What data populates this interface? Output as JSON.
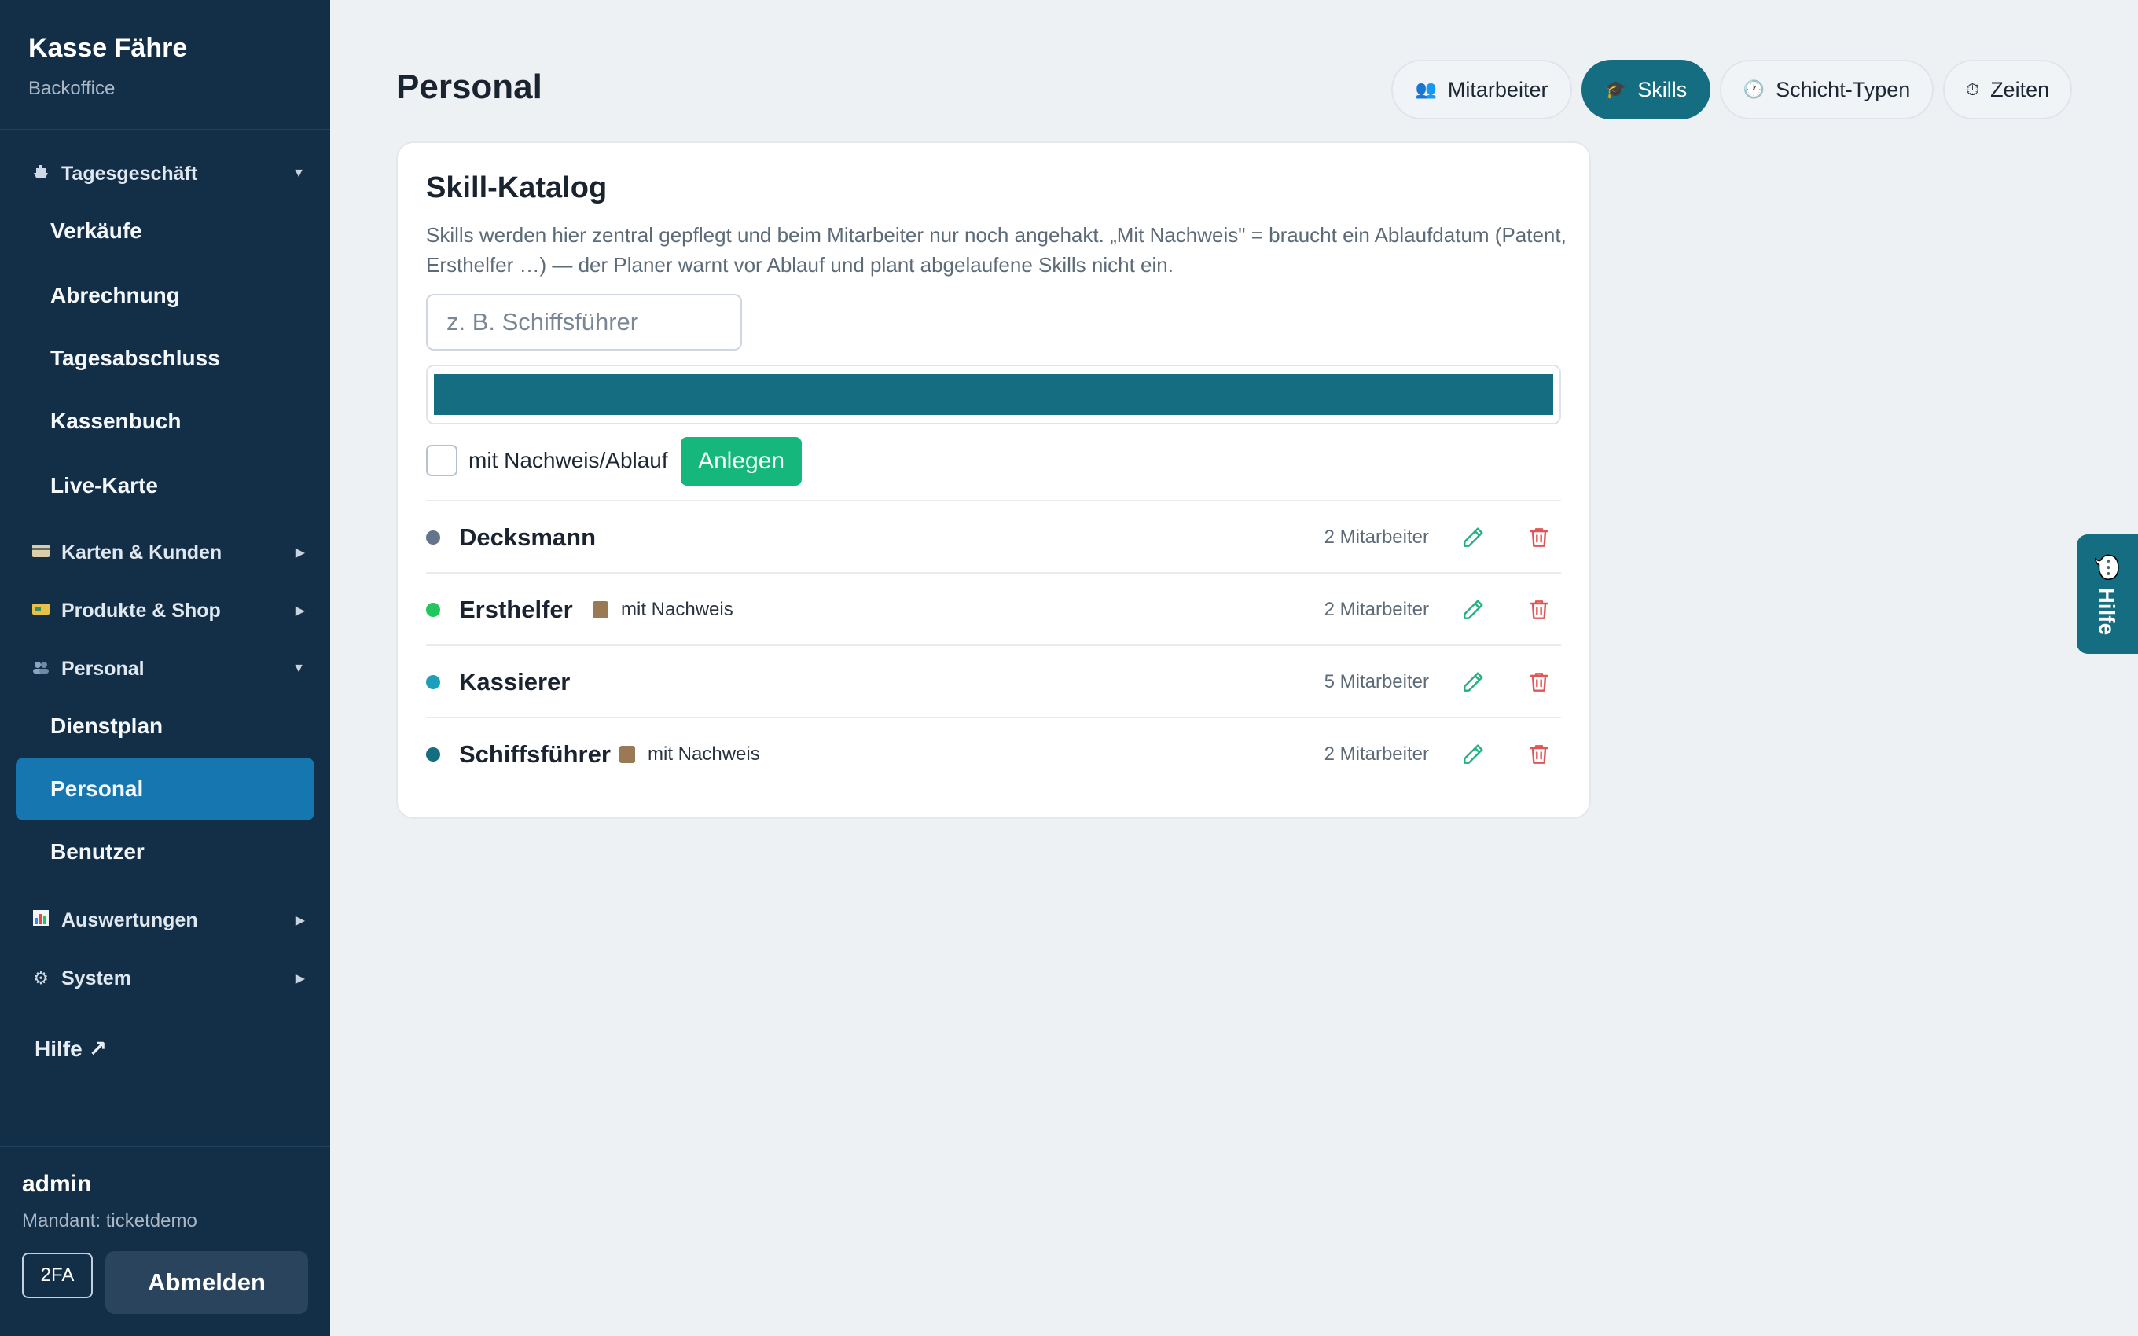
{
  "sidebar": {
    "brand_title": "Kasse Fähre",
    "brand_sub": "Backoffice",
    "groups": {
      "tagesgeschaeft": {
        "label": "Tagesgeschäft",
        "icon": "ship-icon"
      },
      "karten": {
        "label": "Karten & Kunden",
        "icon": "card-icon"
      },
      "produkte": {
        "label": "Produkte & Shop",
        "icon": "ticket-icon"
      },
      "personal": {
        "label": "Personal",
        "icon": "people-icon"
      },
      "auswertungen": {
        "label": "Auswertungen",
        "icon": "chart-icon"
      },
      "system": {
        "label": "System",
        "icon": "gear-icon"
      }
    },
    "items": {
      "verkaeufe": "Verkäufe",
      "abrechnung": "Abrechnung",
      "tagesabschluss": "Tagesabschluss",
      "kassenbuch": "Kassenbuch",
      "livekarte": "Live-Karte",
      "dienstplan": "Dienstplan",
      "personal": "Personal",
      "benutzer": "Benutzer"
    },
    "help_link": "Hilfe ↗",
    "user": "admin",
    "tenant": "Mandant: ticketdemo",
    "btn_2fa": "2FA",
    "btn_logout": "Abmelden"
  },
  "header": {
    "title": "Personal",
    "tabs": [
      {
        "label": "Mitarbeiter",
        "icon": "👥"
      },
      {
        "label": "Skills",
        "icon": "🎓"
      },
      {
        "label": "Schicht-Typen",
        "icon": "🕐"
      },
      {
        "label": "Zeiten",
        "icon": "⏱"
      }
    ]
  },
  "catalog": {
    "title": "Skill-Katalog",
    "description": "Skills werden hier zentral gepflegt und beim Mitarbeiter nur noch angehakt. „Mit Nachweis\" = braucht ein Ablaufdatum (Patent, Ersthelfer …) — der Planer warnt vor Ablauf und plant abgelaufene Skills nicht ein.",
    "input_placeholder": "z. B. Schiffsführer",
    "selected_color": "#146d80",
    "checkbox_label": "mit Nachweis/Ablauf",
    "add_button": "Anlegen",
    "skills": [
      {
        "name": "Decksmann",
        "proof": "",
        "count": "2 Mitarbeiter",
        "color": "#64748b"
      },
      {
        "name": "Ersthelfer",
        "proof": "mit Nachweis",
        "count": "2 Mitarbeiter",
        "color": "#22c55e"
      },
      {
        "name": "Kassierer",
        "proof": "",
        "count": "5 Mitarbeiter",
        "color": "#1aa0b8"
      },
      {
        "name": "Schiffsführer",
        "proof": "mit Nachweis",
        "count": "2 Mitarbeiter",
        "color": "#146d80"
      }
    ]
  },
  "help_tab": "💬 Hilfe"
}
